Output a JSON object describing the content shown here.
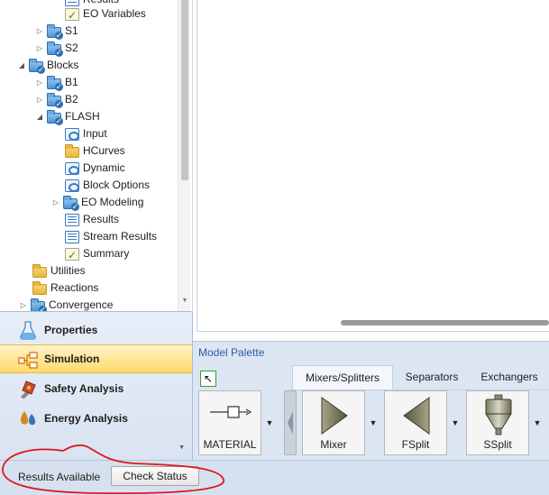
{
  "tree": {
    "items": [
      {
        "label": "Results",
        "icon": "results-icon"
      },
      {
        "label": "EO Variables",
        "icon": "checkmark-icon"
      },
      {
        "label": "S1",
        "icon": "blue-folder-icon",
        "expander": "collapsed"
      },
      {
        "label": "S2",
        "icon": "blue-folder-icon",
        "expander": "collapsed"
      },
      {
        "label": "Blocks",
        "icon": "blue-folder-icon",
        "expander": "expanded"
      },
      {
        "label": "B1",
        "icon": "blue-folder-icon",
        "expander": "collapsed"
      },
      {
        "label": "B2",
        "icon": "blue-folder-icon",
        "expander": "collapsed"
      },
      {
        "label": "FLASH",
        "icon": "blue-folder-icon",
        "expander": "expanded"
      },
      {
        "label": "Input",
        "icon": "form-icon"
      },
      {
        "label": "HCurves",
        "icon": "folder-icon"
      },
      {
        "label": "Dynamic",
        "icon": "form-icon"
      },
      {
        "label": "Block Options",
        "icon": "form-icon"
      },
      {
        "label": "EO Modeling",
        "icon": "blue-folder-icon",
        "expander": "collapsed"
      },
      {
        "label": "Results",
        "icon": "results-icon"
      },
      {
        "label": "Stream Results",
        "icon": "results-icon"
      },
      {
        "label": "Summary",
        "icon": "checkmark-icon"
      },
      {
        "label": "Utilities",
        "icon": "folder-icon"
      },
      {
        "label": "Reactions",
        "icon": "folder-icon"
      },
      {
        "label": "Convergence",
        "icon": "blue-folder-icon",
        "expander": "collapsed"
      }
    ]
  },
  "nav": {
    "items": [
      {
        "label": "Properties",
        "icon": "flask-icon"
      },
      {
        "label": "Simulation",
        "icon": "flowsheet-icon",
        "active": true
      },
      {
        "label": "Safety Analysis",
        "icon": "safety-valve-icon"
      },
      {
        "label": "Energy Analysis",
        "icon": "energy-drops-icon"
      }
    ]
  },
  "palette": {
    "title": "Model Palette",
    "tabs": [
      "Mixers/Splitters",
      "Separators",
      "Exchangers"
    ],
    "active_tab": "Mixers/Splitters",
    "blocks": [
      {
        "label": "MATERIAL",
        "icon": "material-stream-icon"
      },
      {
        "label": "Mixer",
        "icon": "mixer-icon"
      },
      {
        "label": "FSplit",
        "icon": "fsplit-icon"
      },
      {
        "label": "SSplit",
        "icon": "ssplit-icon"
      }
    ]
  },
  "status": {
    "text": "Results Available",
    "button_label": "Check Status"
  },
  "colors": {
    "accent_blue": "#2a5d9e",
    "active_nav": "#ffd96b",
    "annotation_red": "#e0151b"
  }
}
